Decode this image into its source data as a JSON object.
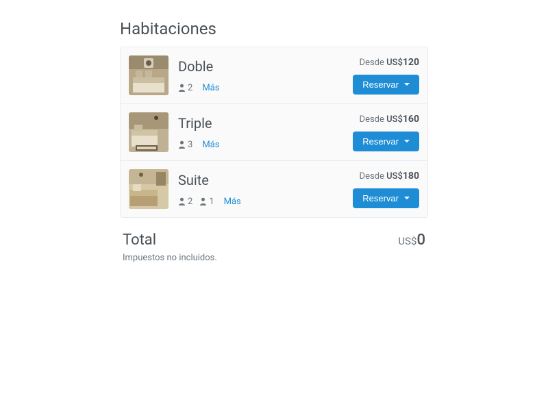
{
  "title": "Habitaciones",
  "labels": {
    "from": "Desde",
    "more": "Más",
    "reserve": "Reservar",
    "total": "Total",
    "tax_note": "Impuestos no incluidos."
  },
  "currency": "US$",
  "rooms": [
    {
      "name": "Doble",
      "occupancy": [
        2
      ],
      "price": "120"
    },
    {
      "name": "Triple",
      "occupancy": [
        3
      ],
      "price": "160"
    },
    {
      "name": "Suite",
      "occupancy": [
        2,
        1
      ],
      "price": "180"
    }
  ],
  "total": "0"
}
